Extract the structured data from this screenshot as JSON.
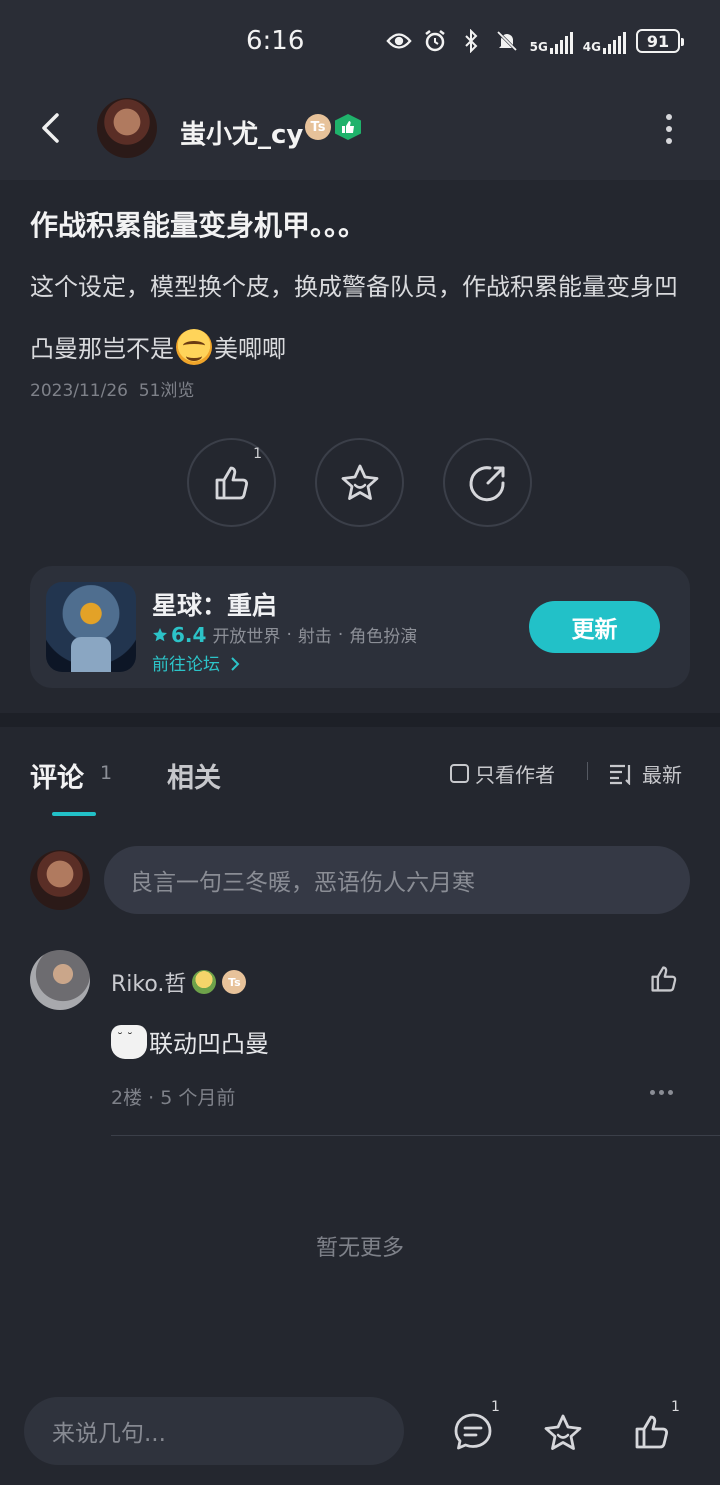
{
  "status_bar": {
    "time": "6:16",
    "network_5g": "5G",
    "network_4g": "4G",
    "battery": "91"
  },
  "header": {
    "username": "蚩小尤_cy",
    "badge_text": "Ts"
  },
  "post": {
    "title": "作战积累能量变身机甲。。。",
    "body_before_emoji": "这个设定，模型换个皮，换成警备队员，作战积累能量变身凹凸曼那岂不是",
    "body_after_emoji": "美唧唧",
    "date": "2023/11/26",
    "views": "51浏览",
    "like_count": "1"
  },
  "game_card": {
    "name": "星球：重启",
    "rating": "6.4",
    "tag1": "开放世界",
    "tag2": "射击",
    "tag3": "角色扮演",
    "dot": "·",
    "forum_link": "前往论坛",
    "update_button": "更新"
  },
  "tabs": {
    "comments_label": "评论",
    "comments_count": "1",
    "related_label": "相关",
    "author_only": "只看作者",
    "sort_label": "最新"
  },
  "comment_input": {
    "placeholder": "良言一句三冬暖，恶语伤人六月寒"
  },
  "comments": [
    {
      "username": "Riko.哲",
      "badge_text": "Ts",
      "text": "联动凹凸曼",
      "floor": "2楼",
      "time": "5 个月前",
      "sep": "·"
    }
  ],
  "no_more": "暂无更多",
  "bottom_bar": {
    "placeholder": "来说几句...",
    "comment_count": "1",
    "like_count": "1"
  },
  "colors": {
    "accent": "#22c1c8",
    "background": "#24272f",
    "header_bg": "#2a2d36"
  }
}
